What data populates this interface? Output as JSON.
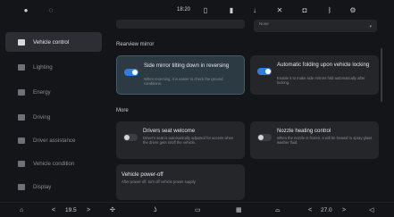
{
  "status": {
    "time": "18:20"
  },
  "sidebar": {
    "items": [
      {
        "label": "Vehicle control",
        "icon": "car-icon",
        "active": true
      },
      {
        "label": "Lighting",
        "icon": "light-icon",
        "active": false
      },
      {
        "label": "Energy",
        "icon": "battery-icon",
        "active": false
      },
      {
        "label": "Driving",
        "icon": "steering-icon",
        "active": false
      },
      {
        "label": "Driver assistance",
        "icon": "assist-icon",
        "active": false
      },
      {
        "label": "Vehicle condition",
        "icon": "condition-icon",
        "active": false
      },
      {
        "label": "Display",
        "icon": "display-icon",
        "active": false
      }
    ]
  },
  "main": {
    "top_dropdown_value": "None",
    "sections": [
      {
        "title": "Rearview mirror"
      },
      {
        "title": "More"
      }
    ],
    "cards": {
      "mirror_tilt": {
        "title": "Side mirror tilting down in reversing",
        "desc": "When reversing, it is easier to check the ground conditions.",
        "on": true
      },
      "auto_fold": {
        "title": "Automatic folding upon vehicle locking",
        "desc": "Enable it to make side mirrors fold automatically after locking.",
        "on": true
      },
      "seat_welcome": {
        "title": "Drivers seat welcome",
        "desc": "Driver's seat is automatically adjusted for access when the driver gets in/off the vehicle.",
        "on": false
      },
      "nozzle_heating": {
        "title": "Nozzle heating control",
        "desc": "When the nozzle is frozen, it will be heated to spray glass washer fluid.",
        "on": false
      },
      "power_off": {
        "title": "Vehicle power-off",
        "desc": "After power-off, turn off vehicle power supply."
      }
    }
  },
  "bottom": {
    "left_temp": "19.5",
    "right_temp": "27.0",
    "left_arrow": "<",
    "right_arrow": ">"
  },
  "colors": {
    "accent": "#2f7de1",
    "background": "#141518",
    "card": "#24262a",
    "card_highlight": "#2c3a44"
  }
}
